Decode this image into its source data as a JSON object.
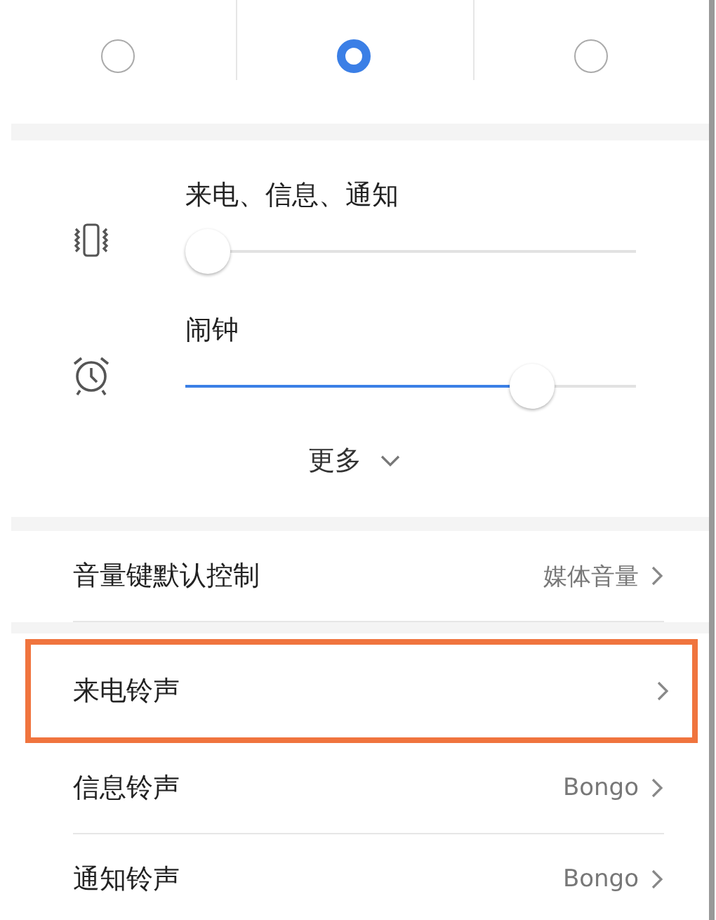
{
  "modes": [
    {
      "selected": false
    },
    {
      "selected": true
    },
    {
      "selected": false
    }
  ],
  "volumes": [
    {
      "kind": "vibrate",
      "label": "来电、信息、通知",
      "level": 0
    },
    {
      "kind": "alarm",
      "label": "闹钟",
      "level": 0.8
    }
  ],
  "more": "更多",
  "settings": [
    {
      "label": "音量键默认控制",
      "value": "媒体音量",
      "highlighted": false
    },
    {
      "label": "来电铃声",
      "highlighted": true
    },
    {
      "label": "信息铃声",
      "value": "Bongo",
      "highlighted": false
    },
    {
      "label": "通知铃声",
      "value": "Bongo",
      "highlighted": false
    }
  ]
}
